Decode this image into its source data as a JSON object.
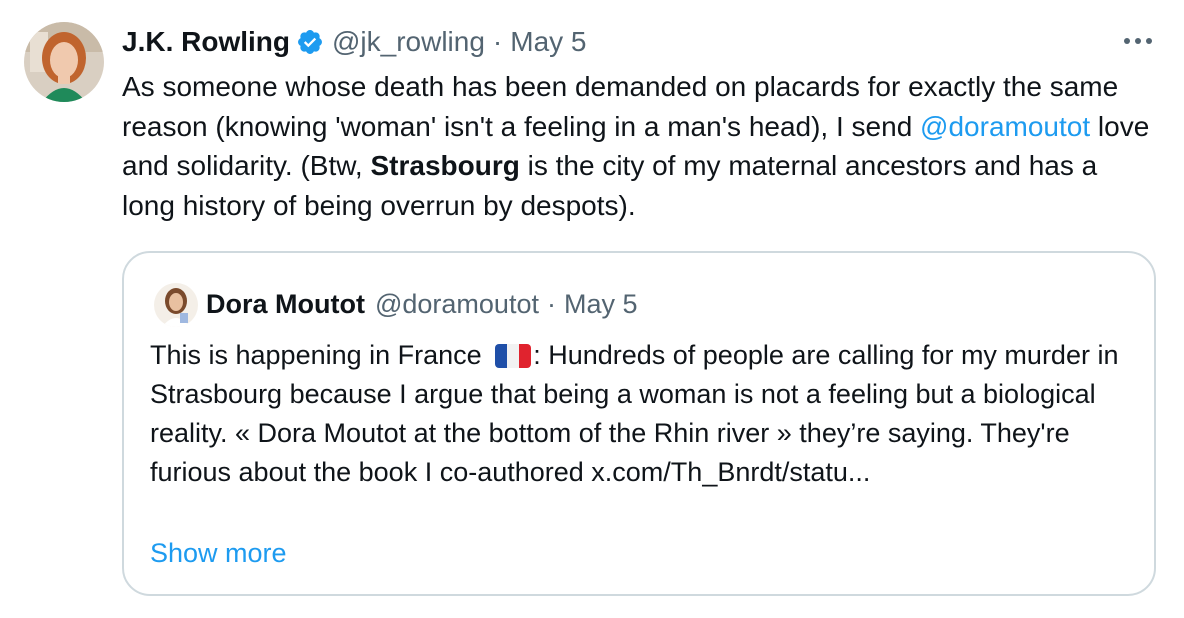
{
  "tweet": {
    "author_name": "J.K. Rowling",
    "handle": "@jk_rowling",
    "separator": "·",
    "date": "May 5",
    "more_icon": "ellipsis-icon",
    "verified_icon": "verified-badge-icon",
    "text_part1": "As someone whose death has been demanded on placards for exactly the same reason (knowing 'woman' isn't a feeling in a man's head), I send ",
    "mention": "@doramoutot",
    "text_part2": " love and solidarity. (Btw, ",
    "bold_word": "Strasbourg",
    "text_part3": " is the city of my maternal ancestors and has a long history of being overrun by despots)."
  },
  "quote": {
    "author_name": "Dora Moutot",
    "handle": "@doramoutot",
    "separator": "·",
    "date": "May 5",
    "text_part1": "This is happening in France ",
    "flag_icon": "france-flag-icon",
    "text_part2": ": Hundreds of people are calling for my murder in Strasbourg because I argue that being a woman is not a feeling but a biological reality. « Dora Moutot at the bottom of the Rhin river » they’re saying. They're furious about the book I co-authored x.com/Th_Bnrdt/statu...",
    "show_more": "Show more"
  },
  "colors": {
    "accent": "#1d9bf0",
    "text": "#0f1419",
    "muted": "#536471",
    "border": "#cfd9de",
    "flag_blue": "#1f4fa8",
    "flag_white": "#f2f2f2",
    "flag_red": "#e0232e"
  }
}
